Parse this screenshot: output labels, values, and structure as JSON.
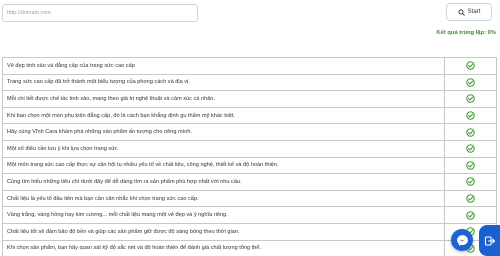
{
  "search": {
    "placeholder": "http://domain.com",
    "value": ""
  },
  "toolbar": {
    "start_label": "Start"
  },
  "summary": {
    "match_rate": "Kết quả trùng lặp: 0%"
  },
  "colors": {
    "check": "#3d9a2f",
    "match_text": "#3d8b2f",
    "fab_blue": "#1e63d6"
  },
  "rows": [
    {
      "text": "Vẻ đẹp tinh xảo và đẳng cấp của trang sức cao cấp",
      "status_icon": "check-circle-icon"
    },
    {
      "text": "Trang sức cao cấp đã trở thành một biểu tượng của phong cách và địa vị.",
      "status_icon": "check-circle-icon"
    },
    {
      "text": "Mỗi chi tiết được chế tác tinh xảo, mang theo giá trị nghệ thuật và cảm xúc cá nhân.",
      "status_icon": "check-circle-icon"
    },
    {
      "text": "Khi bạn chọn một món phụ kiện đẳng cấp, đó là cách bạn khẳng định gu thẩm mỹ khác biệt.",
      "status_icon": "check-circle-icon"
    },
    {
      "text": "Hãy cùng Vĩnh Cara khám phá những sản phẩm ấn tượng cho riêng mình.",
      "status_icon": "check-circle-icon"
    },
    {
      "text": "Một số điều cần lưu ý khi lựa chọn trang sức",
      "status_icon": "check-circle-icon"
    },
    {
      "text": "Một món trang sức cao cấp thực sự cần hội tụ nhiều yếu tố về chất liệu, công nghệ, thiết kế và độ hoàn thiện.",
      "status_icon": "check-circle-icon"
    },
    {
      "text": "Cùng tìm hiểu những tiêu chí dưới đây để dễ dàng tìm ra sản phẩm phù hợp nhất với nhu cầu.",
      "status_icon": "check-circle-icon"
    },
    {
      "text": "Chất liệu là yếu tố đầu tiên mà bạn cần cân nhắc khi chọn trang sức cao cấp.",
      "status_icon": "check-circle-icon"
    },
    {
      "text": "Vàng trắng, vàng hồng hay kim cương... mỗi chất liệu mang một vẻ đẹp và ý nghĩa riêng.",
      "status_icon": "check-circle-icon"
    },
    {
      "text": "Chất liệu tốt sẽ đảm bảo độ bền và giúp các sản phẩm giữ được độ sáng bóng theo thời gian.",
      "status_icon": "check-circle-icon"
    },
    {
      "text": "Khi chọn sản phẩm, bạn hãy quan sát kỹ độ sắc nét và độ hoàn thiện để đánh giá chất lượng tổng thể.",
      "status_icon": "check-circle-icon"
    }
  ],
  "widgets": {
    "messenger_icon": "messenger-icon",
    "side_icon": "exit-icon"
  }
}
